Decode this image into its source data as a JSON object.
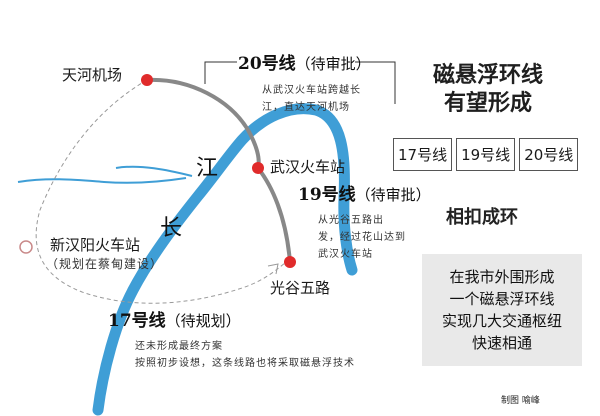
{
  "stations": {
    "tianhe": "天河机场",
    "wuhan": "武汉火车站",
    "guanggu": "光谷五路",
    "xinhanyang": "新汉阳火车站",
    "xinhanyang_note": "（规划在蔡甸建设）"
  },
  "river": {
    "char_jiang": "江",
    "char_chang": "长"
  },
  "line20": {
    "title": "20号线",
    "status": "（待审批）",
    "desc": [
      "从武汉火车站跨越长",
      "江，直达天河机场"
    ],
    "color": "#888888"
  },
  "line19": {
    "title": "19号线",
    "status": "（待审批）",
    "desc": [
      "从光谷五路出",
      "发，经过花山达到",
      "武汉火车站"
    ],
    "color": "#888888"
  },
  "line17": {
    "title": "17号线",
    "status": "（待规划）",
    "desc": [
      "还未形成最终方案",
      "按照初步设想，这条线路也将采取磁悬浮技术"
    ]
  },
  "headline": [
    "磁悬浮环线",
    "有望形成"
  ],
  "lines": [
    "17号线",
    "19号线",
    "20号线"
  ],
  "subhead": "相扣成环",
  "infobox": [
    "在我市外围形成",
    "一个磁悬浮环线",
    "实现几大交通枢纽",
    "快速相通"
  ],
  "credit": "制图  喻峰",
  "colors": {
    "river": "#3f9ed6",
    "tributary": "#3f9ed6",
    "station_dot": "#e02b2b",
    "planned_line": "#b0b0b0",
    "infobox_bg": "#e9e9e9"
  }
}
